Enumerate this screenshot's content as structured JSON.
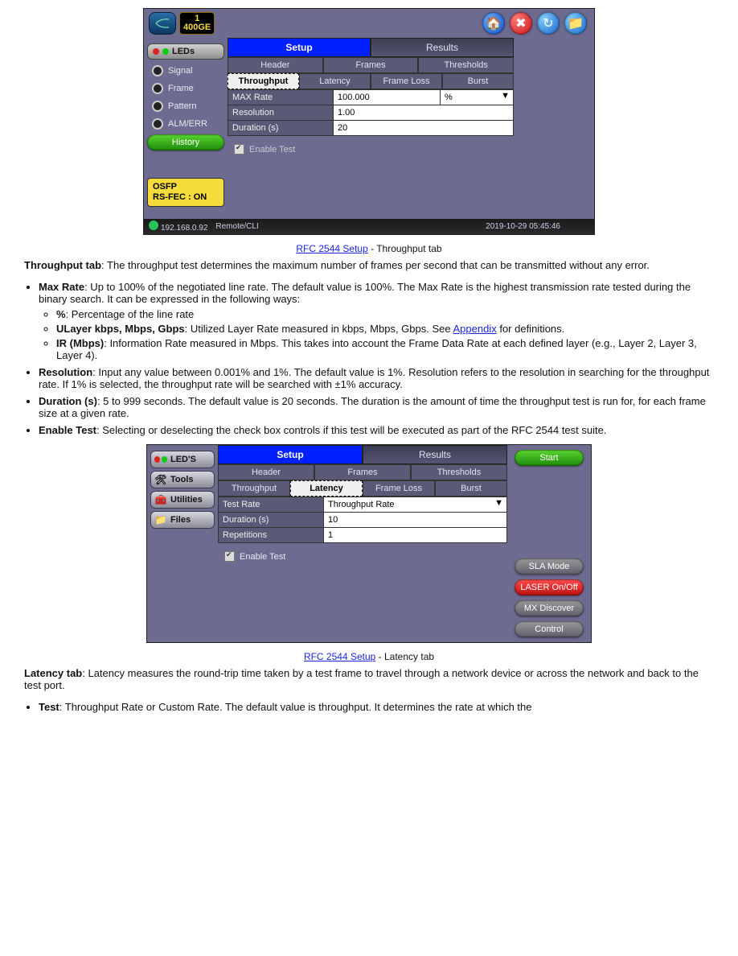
{
  "screenshot1": {
    "badge": {
      "line1": "1",
      "line2": "400GE"
    },
    "sidebar": {
      "leds_label": "LEDs",
      "items": [
        "Signal",
        "Frame",
        "Pattern",
        "ALM/ERR"
      ],
      "history_label": "History",
      "warn_line1": "OSFP",
      "warn_line2": "RS-FEC : ON"
    },
    "tabs": {
      "setup": "Setup",
      "results": "Results"
    },
    "subtabs": [
      "Header",
      "Frames",
      "Thresholds"
    ],
    "ssubtabs": [
      "Throughput",
      "Latency",
      "Frame Loss",
      "Burst"
    ],
    "params": {
      "max_rate_k": "MAX Rate",
      "max_rate_v": "100.000",
      "max_rate_unit": "%",
      "resolution_k": "Resolution",
      "resolution_v": "1.00",
      "duration_k": "Duration (s)",
      "duration_v": "20"
    },
    "enable_label": "Enable Test",
    "status": {
      "ip": "192.168.0.92",
      "mode": "Remote/CLI",
      "datetime": "2019-10-29 05:45:46"
    }
  },
  "caption1": {
    "prefix": "RFC 2544 Setup",
    "suffix": " - Throughput tab"
  },
  "section1": {
    "heading": "Throughput tab",
    "intro": ": The throughput test determines the maximum number of frames per second that can be transmitted without any error.",
    "bullets": {
      "max_rate_lead": "Max Rate",
      "max_rate_body": ": Up to 100% of the negotiated line rate. The default value is 100%. The Max Rate is the highest transmission rate tested during the binary search. It can be expressed in the following ways:",
      "sub1_lead": "%",
      "sub1_body": ": Percentage of the line rate",
      "sub2_lead": "ULayer kbps, Mbps, Gbps",
      "sub2_body": ": Utilized Layer Rate measured in kbps, Mbps, Gbps. See ",
      "sub2_link": "Appendix",
      "sub2_after": " for definitions.",
      "sub3_lead": "IR (Mbps)",
      "sub3_body": ": Information Rate measured in Mbps. This takes into account the Frame Data Rate at each defined layer (e.g., Layer 2, Layer 3, Layer 4).",
      "res_lead": "Resolution",
      "res_body": ": Input any value between 0.001% and 1%. The default value is 1%. Resolution refers to the resolution in searching for the throughput rate. If 1% is selected, the throughput rate will be searched with ±1% accuracy.",
      "dur_lead": "Duration (s)",
      "dur_body": ": 5 to 999 seconds. The default value is 20 seconds. The duration is the amount of time the throughput test is run for, for each frame size at a given rate.",
      "enable_lead": "Enable Test",
      "enable_body": ": Selecting or deselecting the check box controls if this test will be executed as part of the RFC 2544 test suite."
    }
  },
  "screenshot2": {
    "sidebar": [
      "LED'S",
      "Tools",
      "Utilities",
      "Files"
    ],
    "tabs": {
      "setup": "Setup",
      "results": "Results"
    },
    "subtabs": [
      "Header",
      "Frames",
      "Thresholds"
    ],
    "ssubtabs": [
      "Throughput",
      "Latency",
      "Frame Loss",
      "Burst"
    ],
    "params": {
      "test_rate_k": "Test Rate",
      "test_rate_v": "Throughput Rate",
      "duration_k": "Duration (s)",
      "duration_v": "10",
      "rep_k": "Repetitions",
      "rep_v": "1"
    },
    "enable_label": "Enable Test",
    "right": {
      "start": "Start",
      "sla": "SLA Mode",
      "laser": "LASER On/Off",
      "mx": "MX Discover",
      "control": "Control"
    }
  },
  "caption2": {
    "prefix": "RFC 2544 Setup",
    "suffix": " - Latency tab"
  },
  "section2": {
    "heading": "Latency tab",
    "intro": ": Latency measures the round-trip time taken by a test frame to travel through a network device or across the network and back to the test port.",
    "bullet_lead": "Test",
    "bullet_body": ": Throughput Rate or Custom Rate. The default value is throughput. It determines the rate at which the"
  }
}
